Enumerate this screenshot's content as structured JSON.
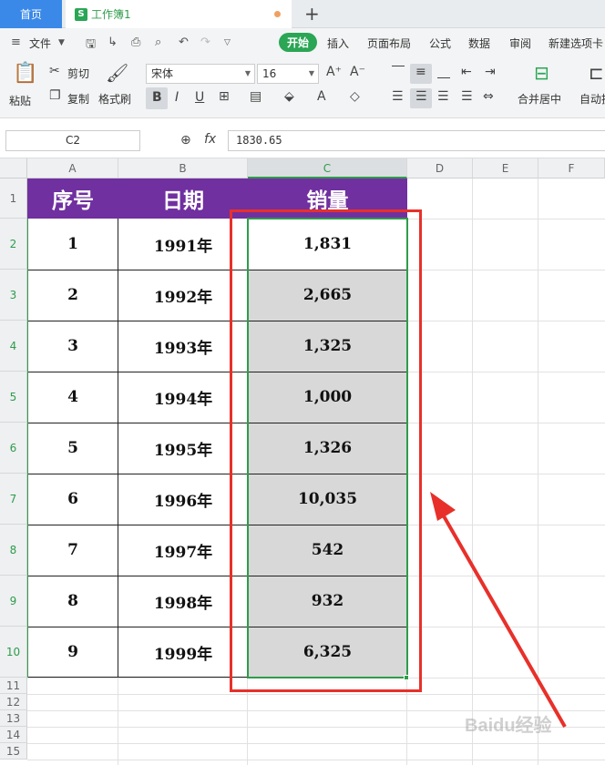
{
  "tabs": {
    "home": "首页",
    "doc": "工作簿1",
    "new_tab": "+"
  },
  "menu": {
    "file": "文件",
    "active": "开始",
    "items": [
      "插入",
      "页面布局",
      "公式",
      "数据",
      "审阅",
      "新建选项卡"
    ]
  },
  "ribbon": {
    "paste": "粘贴",
    "cut": "剪切",
    "copy": "复制",
    "format_painter": "格式刷",
    "font_name": "宋体",
    "font_size": "16",
    "merge_center": "合并居中",
    "auto_wrap": "自动换"
  },
  "formula_bar": {
    "name_box": "C2",
    "fx": "fx",
    "value": "1830.65"
  },
  "columns": [
    "A",
    "B",
    "C",
    "D",
    "E",
    "F"
  ],
  "rows": [
    "1",
    "2",
    "3",
    "4",
    "5",
    "6",
    "7",
    "8",
    "9",
    "10",
    "11",
    "12",
    "13",
    "14",
    "15"
  ],
  "table": {
    "headers": [
      "序号",
      "日期",
      "销量"
    ],
    "data": [
      [
        "1",
        "1991年",
        "1,831"
      ],
      [
        "2",
        "1992年",
        "2,665"
      ],
      [
        "3",
        "1993年",
        "1,325"
      ],
      [
        "4",
        "1994年",
        "1,000"
      ],
      [
        "5",
        "1995年",
        "1,326"
      ],
      [
        "6",
        "1996年",
        "10,035"
      ],
      [
        "7",
        "1997年",
        "542"
      ],
      [
        "8",
        "1998年",
        "932"
      ],
      [
        "9",
        "1999年",
        "6,325"
      ]
    ]
  },
  "colors": {
    "header_fill": "#7030a0",
    "selection": "#2e9c4a",
    "annotation": "#e8302a",
    "accent": "#2aa655"
  },
  "watermark": "Baidu经验"
}
